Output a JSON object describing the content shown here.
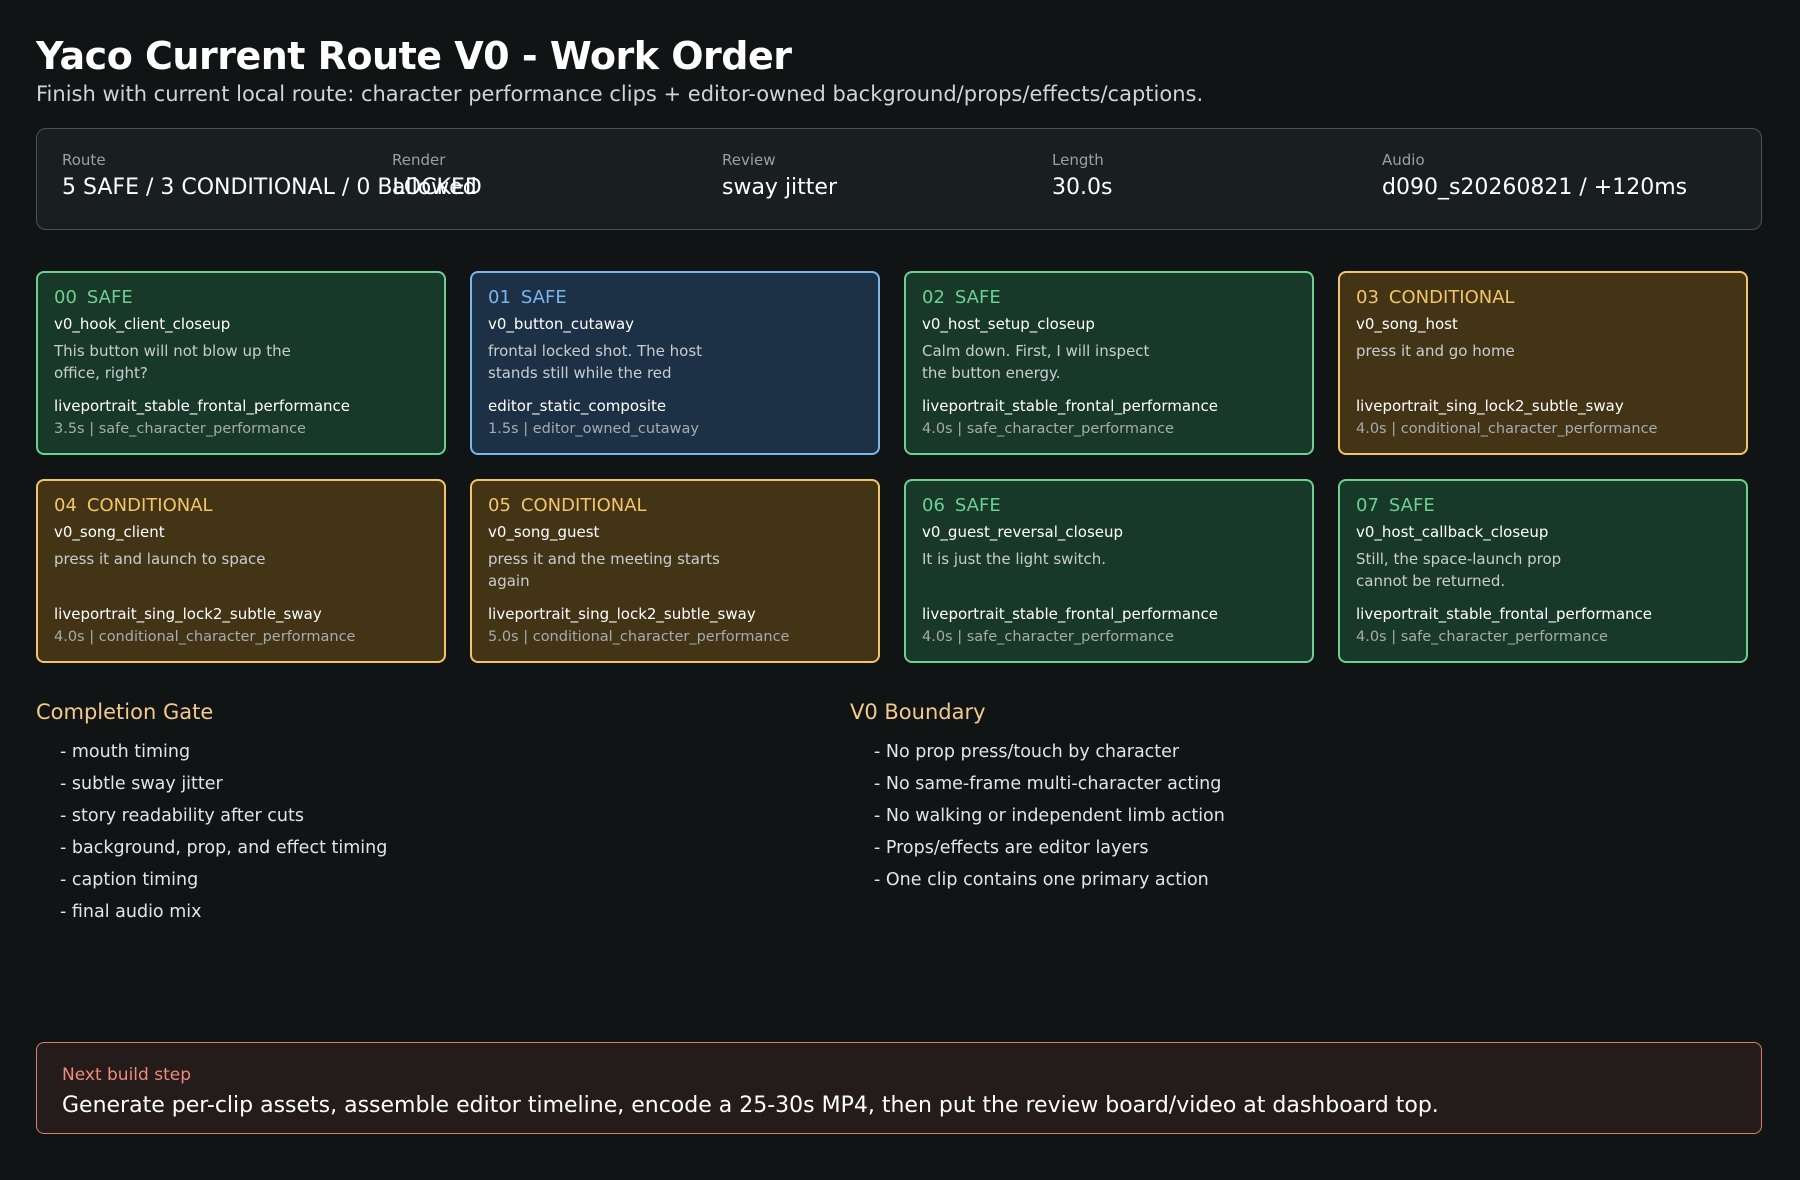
{
  "page": {
    "title": "Yaco Current Route V0 - Work Order",
    "subtitle": "Finish with current local route: character performance clips + editor-owned background/props/effects/captions."
  },
  "summary": {
    "items": [
      {
        "label": "Route",
        "value": "5 SAFE / 3 CONDITIONAL / 0 BLOCKED"
      },
      {
        "label": "Render",
        "value": "allowed"
      },
      {
        "label": "Review",
        "value": "sway jitter"
      },
      {
        "label": "Length",
        "value": "30.0s"
      },
      {
        "label": "Audio",
        "value": "d090_s20260821 / +120ms"
      }
    ]
  },
  "clips": [
    {
      "id": "00",
      "status": "SAFE",
      "name": "v0_hook_client_closeup",
      "line1": "This button will not blow up the",
      "line2": "office, right?",
      "method": "liveportrait_stable_frontal_performance",
      "meta": "3.5s | safe_character_performance"
    },
    {
      "id": "01",
      "status": "SAFE",
      "name": "v0_button_cutaway",
      "line1": "frontal locked shot. The host",
      "line2": "stands still while the red",
      "method": "editor_static_composite",
      "meta": "1.5s | editor_owned_cutaway"
    },
    {
      "id": "02",
      "status": "SAFE",
      "name": "v0_host_setup_closeup",
      "line1": "Calm down. First, I will inspect",
      "line2": "the button energy.",
      "method": "liveportrait_stable_frontal_performance",
      "meta": "4.0s | safe_character_performance"
    },
    {
      "id": "03",
      "status": "CONDITIONAL",
      "name": "v0_song_host",
      "line1": "press it and go home",
      "line2": "",
      "method": "liveportrait_sing_lock2_subtle_sway",
      "meta": "4.0s | conditional_character_performance"
    },
    {
      "id": "04",
      "status": "CONDITIONAL",
      "name": "v0_song_client",
      "line1": "press it and launch to space",
      "line2": "",
      "method": "liveportrait_sing_lock2_subtle_sway",
      "meta": "4.0s | conditional_character_performance"
    },
    {
      "id": "05",
      "status": "CONDITIONAL",
      "name": "v0_song_guest",
      "line1": "press it and the meeting starts",
      "line2": "again",
      "method": "liveportrait_sing_lock2_subtle_sway",
      "meta": "5.0s | conditional_character_performance"
    },
    {
      "id": "06",
      "status": "SAFE",
      "name": "v0_guest_reversal_closeup",
      "line1": "It is just the light switch.",
      "line2": "",
      "method": "liveportrait_stable_frontal_performance",
      "meta": "4.0s | safe_character_performance"
    },
    {
      "id": "07",
      "status": "SAFE",
      "name": "v0_host_callback_closeup",
      "line1": "Still, the space-launch prop",
      "line2": "cannot be returned.",
      "method": "liveportrait_stable_frontal_performance",
      "meta": "4.0s | safe_character_performance"
    }
  ],
  "colors": {
    "safe": "#6cd18f",
    "conditional": "#f3c46a",
    "cutaway": "#7ab7ec",
    "next_step": "#f08a7b",
    "section_title": "#f3c98c"
  },
  "completion_gate": {
    "title": "Completion Gate",
    "items": [
      "- mouth timing",
      "- subtle sway jitter",
      "- story readability after cuts",
      "- background, prop, and effect timing",
      "- caption timing",
      "- final audio mix"
    ]
  },
  "boundary": {
    "title": "V0 Boundary",
    "items": [
      "- No prop press/touch by character",
      "- No same-frame multi-character acting",
      "- No walking or independent limb action",
      "- Props/effects are editor layers",
      "- One clip contains one primary action"
    ]
  },
  "next_step": {
    "label": "Next build step",
    "text": "Generate per-clip assets, assemble editor timeline, encode a 25-30s MP4, then put the review board/video at dashboard top."
  }
}
